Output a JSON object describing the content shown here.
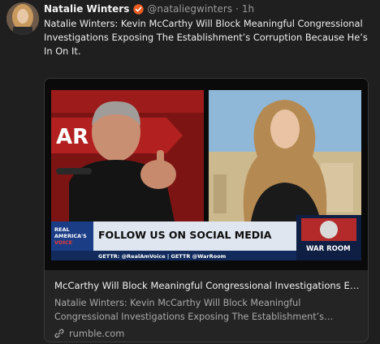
{
  "author": {
    "name": "Natalie Winters",
    "handle": "@nataliegwinters",
    "separator": "·",
    "time": "1h"
  },
  "post": {
    "text": "Natalie Winters: Kevin McCarthy Will Block Meaningful Congressional Investigations Exposing The Establishment’s Corruption Because He’s In On It."
  },
  "card": {
    "image": {
      "banner": "FOLLOW US ON SOCIAL MEDIA",
      "banner_sub": "GETTR: @RealAmVoice | GETTR @WarRoom",
      "network_logo_line1": "REAL",
      "network_logo_line2": "AMERICA'S",
      "network_logo_line3": "VOICE",
      "show_logo": "WAR ROOM",
      "backdrop_text": "AR R  M"
    },
    "title": "McCarthy Will Block Meaningful Congressional Investigations Expo…",
    "description": "Natalie Winters: Kevin McCarthy Will Block Meaningful Congressional Investigations Exposing The Establishment’s…",
    "domain": "rumble.com"
  },
  "icons": {
    "verified": "verified-badge-icon",
    "link": "link-icon"
  },
  "colors": {
    "background": "#1f1f1f",
    "verified_orange": "#e85d22",
    "muted": "#9a9a9a"
  }
}
